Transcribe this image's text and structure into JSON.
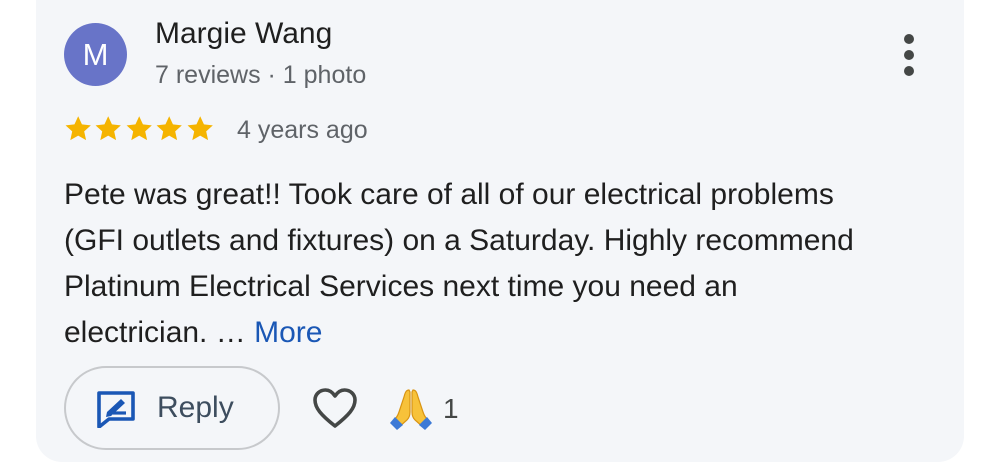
{
  "review": {
    "avatar_initial": "M",
    "avatar_color": "#6874c8",
    "author_name": "Margie Wang",
    "author_meta": "7 reviews · 1 photo",
    "rating": 5,
    "rating_max": 5,
    "star_color": "#f5b400",
    "date": "4 years ago",
    "text_lines": [
      "Pete was great!! Took care of all of our electrical problems",
      "(GFI outlets and fixtures) on a Saturday. Highly recommend",
      "Platinum Electrical Services next time you need an",
      "electrician. … "
    ],
    "more_label": "More",
    "link_color": "#1a57b5"
  },
  "actions": {
    "reply_label": "Reply",
    "reply_icon": "reply-edit-icon",
    "like_icon": "heart-icon",
    "reaction_icon": "folded-hands-emoji",
    "reaction_count": "1"
  },
  "menu": {
    "icon": "more-vert-icon"
  }
}
